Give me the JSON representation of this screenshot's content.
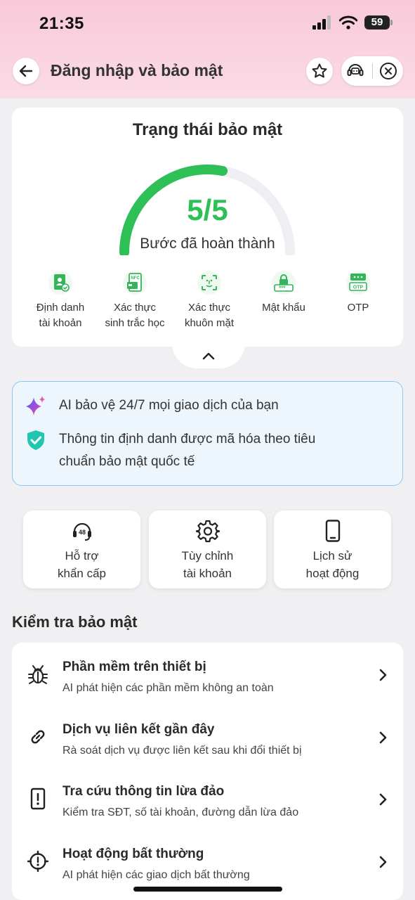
{
  "status_bar": {
    "time": "21:35",
    "battery": "59"
  },
  "header": {
    "title": "Đăng nhập và bảo mật"
  },
  "security_status": {
    "title": "Trạng thái bảo mật",
    "score": "5/5",
    "score_label": "Bước đã hoàn thành",
    "progress_fraction": 0.56,
    "colors": {
      "progress": "#2fbf57",
      "track": "#eeeef3"
    },
    "steps": [
      {
        "icon": "id-card-check-icon",
        "line1": "Định danh",
        "line2": "tài khoản"
      },
      {
        "icon": "nfc-card-icon",
        "line1": "Xác thực",
        "line2": "sinh trắc học"
      },
      {
        "icon": "face-scan-icon",
        "line1": "Xác thực",
        "line2": "khuôn mặt"
      },
      {
        "icon": "lock-password-icon",
        "line1": "Mật khẩu",
        "line2": ""
      },
      {
        "icon": "otp-icon",
        "line1": "OTP",
        "line2": ""
      }
    ]
  },
  "info_box": {
    "line1": "AI bảo vệ 24/7 mọi giao dịch của bạn",
    "line2a": "Thông tin định danh được mã hóa theo tiêu",
    "line2b": "chuẩn bảo mật quốc tế"
  },
  "quick_actions": [
    {
      "icon": "headset-48-icon",
      "line1": "Hỗ trợ",
      "line2": "khẩn cấp"
    },
    {
      "icon": "gear-icon",
      "line1": "Tùy chỉnh",
      "line2": "tài khoản"
    },
    {
      "icon": "phone-icon",
      "line1": "Lịch sử",
      "line2": "hoạt động"
    }
  ],
  "security_check": {
    "title": "Kiểm tra bảo mật",
    "items": [
      {
        "icon": "bug-icon",
        "title": "Phần mềm trên thiết bị",
        "subtitle": "AI phát hiện các phần mềm không an toàn"
      },
      {
        "icon": "link-icon",
        "title": "Dịch vụ liên kết gần đây",
        "subtitle": "Rà soát dịch vụ được liên kết sau khi đổi thiết bị"
      },
      {
        "icon": "alert-box-icon",
        "title": "Tra cứu thông tin lừa đảo",
        "subtitle": "Kiểm tra SĐT, số tài khoản, đường dẫn lừa đảo"
      },
      {
        "icon": "crosshair-alert-icon",
        "title": "Hoạt động bất thường",
        "subtitle": "AI phát hiện các giao dịch bất thường"
      }
    ]
  }
}
